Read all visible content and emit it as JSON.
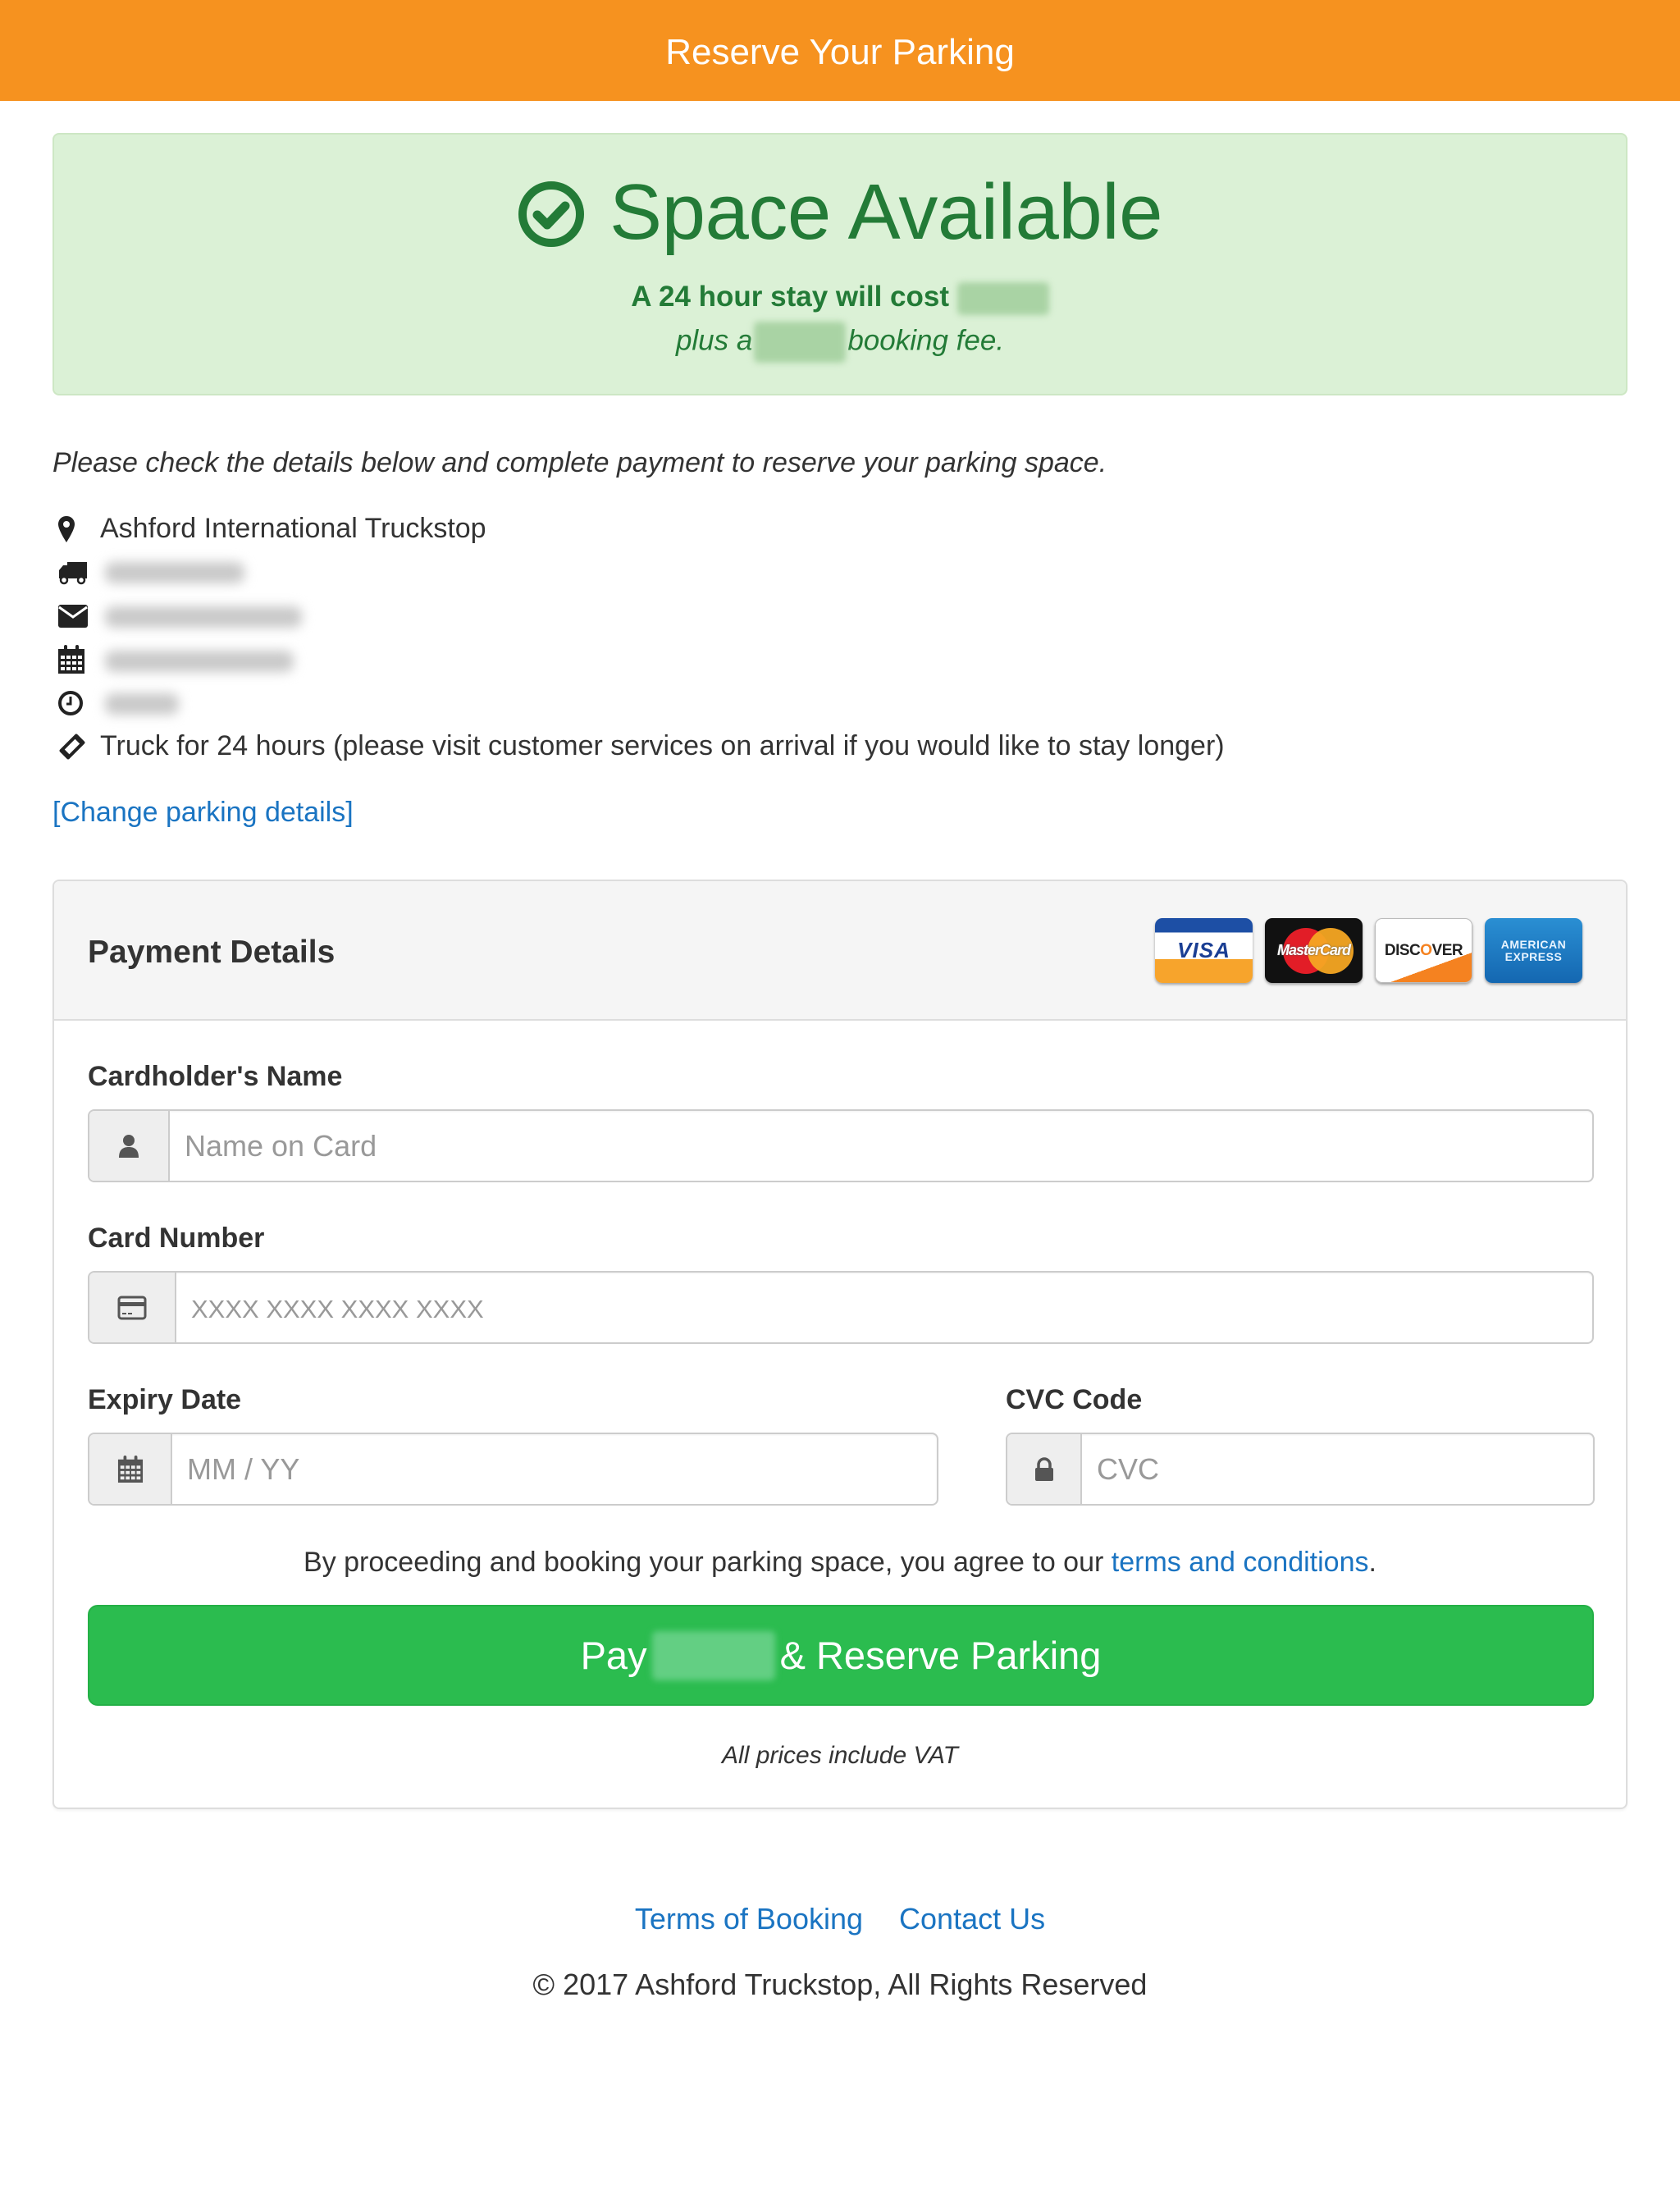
{
  "header": {
    "title": "Reserve Your Parking",
    "color": "#f6921f"
  },
  "alert": {
    "icon": "check-circle-icon",
    "heading": "Space Available",
    "cost_prefix": "A 24 hour stay will cost",
    "cost_value": "[redacted]",
    "fee_prefix": "plus a",
    "fee_value": "[redacted]",
    "fee_suffix": "booking fee.",
    "color": "#237b37",
    "background": "#dbf1d6"
  },
  "intro": "Please check the details below and complete payment to reserve your parking space.",
  "details": [
    {
      "icon": "map-marker-icon",
      "text": "Ashford International Truckstop",
      "redacted": false
    },
    {
      "icon": "truck-icon",
      "text": "[redacted]",
      "redacted": true
    },
    {
      "icon": "envelope-icon",
      "text": "[redacted]",
      "redacted": true
    },
    {
      "icon": "calendar-icon",
      "text": "[redacted]",
      "redacted": true
    },
    {
      "icon": "clock-icon",
      "text": "[redacted]",
      "redacted": true
    },
    {
      "icon": "ticket-icon",
      "text": "Truck for 24 hours (please visit customer services on arrival if you would like to stay longer)",
      "redacted": false
    }
  ],
  "change_link": "[Change parking details]",
  "payment": {
    "title": "Payment Details",
    "accepted_cards": [
      "VISA",
      "MasterCard",
      "DISCOVER",
      "AMERICAN EXPRESS"
    ],
    "fields": {
      "name": {
        "label": "Cardholder's Name",
        "placeholder": "Name on Card",
        "value": "",
        "icon": "user-icon"
      },
      "number": {
        "label": "Card Number",
        "placeholder": "XXXX XXXX XXXX XXXX",
        "value": "",
        "icon": "credit-card-icon"
      },
      "expiry": {
        "label": "Expiry Date",
        "placeholder": "MM / YY",
        "value": "",
        "icon": "calendar-icon"
      },
      "cvc": {
        "label": "CVC Code",
        "placeholder": "CVC",
        "value": "",
        "icon": "lock-icon"
      }
    },
    "agree_prefix": "By proceeding and booking your parking space, you agree to our",
    "agree_link": "terms and conditions",
    "agree_suffix": ".",
    "pay_button": {
      "prefix": "Pay",
      "amount": "[redacted]",
      "suffix": "& Reserve Parking",
      "color": "#2bbc4f"
    },
    "vat_note": "All prices include VAT"
  },
  "footer": {
    "links": [
      "Terms of Booking",
      "Contact Us"
    ],
    "copyright": "© 2017 Ashford Truckstop, All Rights Reserved",
    "link_color": "#1a74c2"
  }
}
